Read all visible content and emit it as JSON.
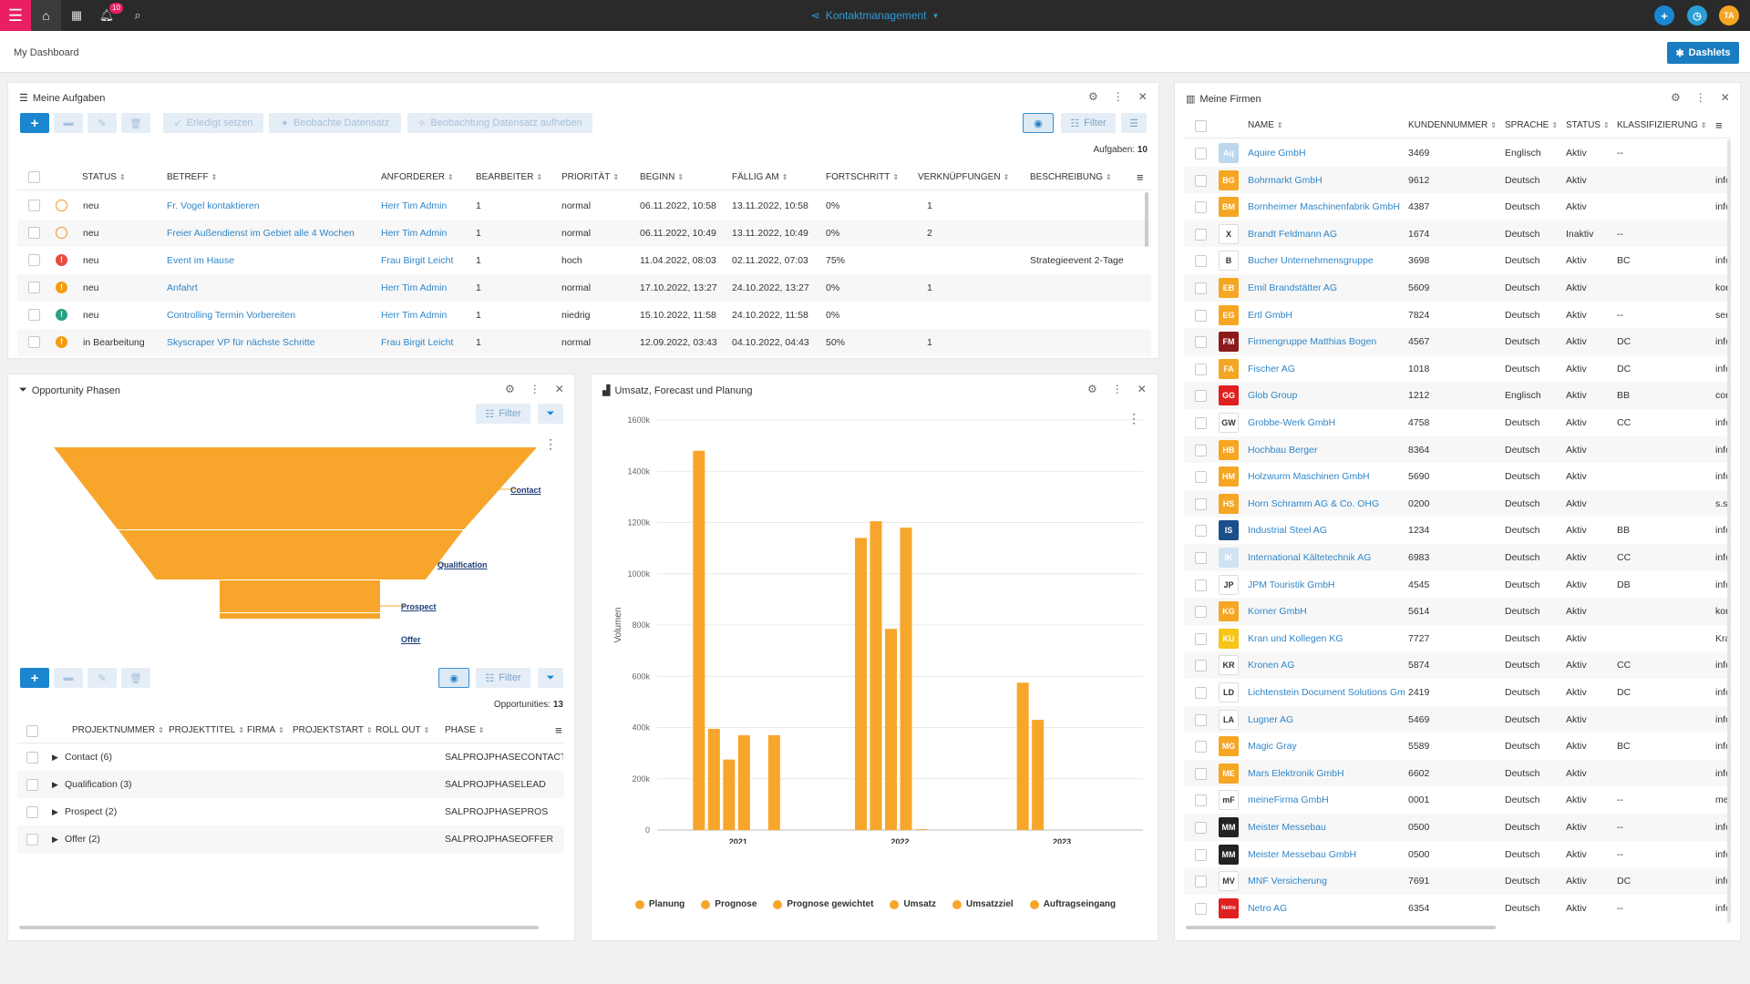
{
  "topbar": {
    "app_title": "Kontaktmanagement",
    "notification_count": "10",
    "user_initials": "TA"
  },
  "header": {
    "title": "My Dashboard",
    "dashlets_label": "Dashlets"
  },
  "tasks": {
    "title": "Meine Aufgaben",
    "toolbar": {
      "erledigt": "Erledigt setzen",
      "beobachte": "Beobachte Datensatz",
      "beobachtung_aufheben": "Beobachtung Datensatz aufheben",
      "filter": "Filter"
    },
    "count_label": "Aufgaben:",
    "count_value": "10",
    "columns": [
      "STATUS",
      "BETREFF",
      "ANFORDERER",
      "BEARBEITER",
      "PRIORITÄT",
      "BEGINN",
      "FÄLLIG AM",
      "FORTSCHRITT",
      "VERKNÜPFUNGEN",
      "BESCHREIBUNG"
    ],
    "rows": [
      {
        "icon": "open",
        "status": "neu",
        "betreff": "Fr. Vogel kontaktieren",
        "anforderer": "Herr Tim Admin",
        "bearbeiter": "1",
        "prioritaet": "normal",
        "beginn": "06.11.2022, 10:58",
        "faellig": "13.11.2022, 10:58",
        "fortschritt": "0%",
        "verknuepfungen": "1",
        "beschreibung": ""
      },
      {
        "icon": "open",
        "status": "neu",
        "betreff": "Freier Außendienst im Gebiet alle 4 Wochen",
        "anforderer": "Herr Tim Admin",
        "bearbeiter": "1",
        "prioritaet": "normal",
        "beginn": "06.11.2022, 10:49",
        "faellig": "13.11.2022, 10:49",
        "fortschritt": "0%",
        "verknuepfungen": "2",
        "beschreibung": ""
      },
      {
        "icon": "high",
        "status": "neu",
        "betreff": "Event im Hause",
        "anforderer": "Frau Birgit Leicht",
        "bearbeiter": "1",
        "prioritaet": "hoch",
        "beginn": "11.04.2022, 08:03",
        "faellig": "02.11.2022, 07:03",
        "fortschritt": "75%",
        "verknuepfungen": "",
        "beschreibung": "Strategieevent 2-Tage"
      },
      {
        "icon": "normal",
        "status": "neu",
        "betreff": "Anfahrt",
        "anforderer": "Herr Tim Admin",
        "bearbeiter": "1",
        "prioritaet": "normal",
        "beginn": "17.10.2022, 13:27",
        "faellig": "24.10.2022, 13:27",
        "fortschritt": "0%",
        "verknuepfungen": "1",
        "beschreibung": ""
      },
      {
        "icon": "low",
        "status": "neu",
        "betreff": "Controlling Termin Vorbereiten",
        "anforderer": "Herr Tim Admin",
        "bearbeiter": "1",
        "prioritaet": "niedrig",
        "beginn": "15.10.2022, 11:58",
        "faellig": "24.10.2022, 11:58",
        "fortschritt": "0%",
        "verknuepfungen": "",
        "beschreibung": ""
      },
      {
        "icon": "normal",
        "status": "in Bearbeitung",
        "betreff": "Skyscraper VP für nächste Schritte",
        "anforderer": "Frau Birgit Leicht",
        "bearbeiter": "1",
        "prioritaet": "normal",
        "beginn": "12.09.2022, 03:43",
        "faellig": "04.10.2022, 04:43",
        "fortschritt": "50%",
        "verknuepfungen": "1",
        "beschreibung": ""
      }
    ]
  },
  "opportunities": {
    "title": "Opportunity Phasen",
    "filter_label": "Filter",
    "funnel_labels": [
      "Contact",
      "Qualification",
      "Prospect",
      "Offer"
    ],
    "count_label": "Opportunities:",
    "count_value": "13",
    "columns": [
      "PROJEKTNUMMER",
      "PROJEKTTITEL",
      "FIRMA",
      "PROJEKTSTART",
      "ROLL OUT",
      "PHASE"
    ],
    "groups": [
      {
        "label": "Contact (6)",
        "phase": "SALPROJPHASECONTACT"
      },
      {
        "label": "Qualification (3)",
        "phase": "SALPROJPHASELEAD"
      },
      {
        "label": "Prospect (2)",
        "phase": "SALPROJPHASEPROS"
      },
      {
        "label": "Offer (2)",
        "phase": "SALPROJPHASEOFFER"
      }
    ]
  },
  "revenue": {
    "title": "Umsatz, Forecast und Planung"
  },
  "chart_data": {
    "type": "bar",
    "title": "",
    "ylabel": "Volumen",
    "ylim": [
      0,
      1600
    ],
    "yticks": [
      "0",
      "200k",
      "400k",
      "600k",
      "800k",
      "1000k",
      "1200k",
      "1400k",
      "1600k"
    ],
    "categories": [
      "2021",
      "2022",
      "2023"
    ],
    "series": [
      {
        "name": "Planung",
        "values": [
          1480,
          1140,
          575
        ]
      },
      {
        "name": "Prognose",
        "values": [
          395,
          1205,
          430
        ]
      },
      {
        "name": "Prognose gewichtet",
        "values": [
          275,
          785,
          0
        ]
      },
      {
        "name": "Umsatz",
        "values": [
          370,
          1180,
          0
        ]
      },
      {
        "name": "Umsatzziel",
        "values": [
          0,
          3,
          0
        ]
      },
      {
        "name": "Auftragseingang",
        "values": [
          370,
          0,
          0
        ]
      }
    ],
    "colors": {
      "bar": "#f7a62b"
    },
    "grid": true,
    "legend": "bottom"
  },
  "companies": {
    "title": "Meine Firmen",
    "columns": [
      "NAME",
      "KUNDENNUMMER",
      "SPRACHE",
      "STATUS",
      "KLASSIFIZIERUNG"
    ],
    "rows": [
      {
        "logo": "Aq",
        "color": "#bcd7ee",
        "name": "Aquire GmbH",
        "nr": "3469",
        "sprache": "Englisch",
        "status": "Aktiv",
        "klass": "--",
        "extra": ""
      },
      {
        "logo": "BG",
        "color": "#f5a623",
        "name": "Bohrmarkt GmbH",
        "nr": "9612",
        "sprache": "Deutsch",
        "status": "Aktiv",
        "klass": "",
        "extra": "info"
      },
      {
        "logo": "BM",
        "color": "#f5a623",
        "name": "Bornheimer Maschinenfabrik GmbH",
        "nr": "4387",
        "sprache": "Deutsch",
        "status": "Aktiv",
        "klass": "",
        "extra": "info"
      },
      {
        "logo": "X",
        "color": "#ffffff",
        "name": "Brandt Feldmann AG",
        "nr": "1674",
        "sprache": "Deutsch",
        "status": "Inaktiv",
        "klass": "--",
        "extra": ""
      },
      {
        "logo": "B",
        "color": "#ffffff",
        "name": "Bucher Unternehmensgruppe",
        "nr": "3698",
        "sprache": "Deutsch",
        "status": "Aktiv",
        "klass": "BC",
        "extra": "info"
      },
      {
        "logo": "EB",
        "color": "#f5a623",
        "name": "Emil Brandstätter AG",
        "nr": "5609",
        "sprache": "Deutsch",
        "status": "Aktiv",
        "klass": "",
        "extra": "kor"
      },
      {
        "logo": "EG",
        "color": "#f5a623",
        "name": "Ertl GmbH",
        "nr": "7824",
        "sprache": "Deutsch",
        "status": "Aktiv",
        "klass": "--",
        "extra": "ser"
      },
      {
        "logo": "FM",
        "color": "#8b1a1a",
        "name": "Firmengruppe Matthias Bogen",
        "nr": "4567",
        "sprache": "Deutsch",
        "status": "Aktiv",
        "klass": "DC",
        "extra": "info"
      },
      {
        "logo": "FA",
        "color": "#f5a623",
        "name": "Fischer AG",
        "nr": "1018",
        "sprache": "Deutsch",
        "status": "Aktiv",
        "klass": "DC",
        "extra": "info"
      },
      {
        "logo": "GG",
        "color": "#e02020",
        "name": "Glob Group",
        "nr": "1212",
        "sprache": "Englisch",
        "status": "Aktiv",
        "klass": "BB",
        "extra": "cor"
      },
      {
        "logo": "GW",
        "color": "#ffffff",
        "name": "Grobbe-Werk GmbH",
        "nr": "4758",
        "sprache": "Deutsch",
        "status": "Aktiv",
        "klass": "CC",
        "extra": "info"
      },
      {
        "logo": "HB",
        "color": "#f5a623",
        "name": "Hochbau Berger",
        "nr": "8364",
        "sprache": "Deutsch",
        "status": "Aktiv",
        "klass": "",
        "extra": "info"
      },
      {
        "logo": "HM",
        "color": "#f5a623",
        "name": "Holzwurm Maschinen GmbH",
        "nr": "5690",
        "sprache": "Deutsch",
        "status": "Aktiv",
        "klass": "",
        "extra": "info"
      },
      {
        "logo": "HS",
        "color": "#f5a623",
        "name": "Horn Schramm AG & Co. OHG",
        "nr": "0200",
        "sprache": "Deutsch",
        "status": "Aktiv",
        "klass": "",
        "extra": "s.sc"
      },
      {
        "logo": "IS",
        "color": "#1b4f8a",
        "name": "Industrial Steel AG",
        "nr": "1234",
        "sprache": "Deutsch",
        "status": "Aktiv",
        "klass": "BB",
        "extra": "info"
      },
      {
        "logo": "IK",
        "color": "#cfe3f5",
        "name": "International Kältetechnik AG",
        "nr": "6983",
        "sprache": "Deutsch",
        "status": "Aktiv",
        "klass": "CC",
        "extra": "info"
      },
      {
        "logo": "JP",
        "color": "#ffffff",
        "name": "JPM Touristik GmbH",
        "nr": "4545",
        "sprache": "Deutsch",
        "status": "Aktiv",
        "klass": "DB",
        "extra": "info"
      },
      {
        "logo": "KG",
        "color": "#f5a623",
        "name": "Korner GmbH",
        "nr": "5614",
        "sprache": "Deutsch",
        "status": "Aktiv",
        "klass": "",
        "extra": "kor"
      },
      {
        "logo": "KU",
        "color": "#f5c518",
        "name": "Kran und Kollegen KG",
        "nr": "7727",
        "sprache": "Deutsch",
        "status": "Aktiv",
        "klass": "",
        "extra": "Kra"
      },
      {
        "logo": "KR",
        "color": "#ffffff",
        "name": "Kronen AG",
        "nr": "5874",
        "sprache": "Deutsch",
        "status": "Aktiv",
        "klass": "CC",
        "extra": "info"
      },
      {
        "logo": "LD",
        "color": "#ffffff",
        "name": "Lichtenstein Document Solutions GmbH",
        "nr": "2419",
        "sprache": "Deutsch",
        "status": "Aktiv",
        "klass": "DC",
        "extra": "info"
      },
      {
        "logo": "LA",
        "color": "#ffffff",
        "name": "Lugner AG",
        "nr": "5469",
        "sprache": "Deutsch",
        "status": "Aktiv",
        "klass": "",
        "extra": "info"
      },
      {
        "logo": "MG",
        "color": "#f5a623",
        "name": "Magic Gray",
        "nr": "5589",
        "sprache": "Deutsch",
        "status": "Aktiv",
        "klass": "BC",
        "extra": "info"
      },
      {
        "logo": "ME",
        "color": "#f5a623",
        "name": "Mars Elektronik GmbH",
        "nr": "6602",
        "sprache": "Deutsch",
        "status": "Aktiv",
        "klass": "",
        "extra": "info"
      },
      {
        "logo": "mF",
        "color": "#ffffff",
        "name": "meineFirma GmbH",
        "nr": "0001",
        "sprache": "Deutsch",
        "status": "Aktiv",
        "klass": "--",
        "extra": "me"
      },
      {
        "logo": "MM",
        "color": "#222222",
        "name": "Meister Messebau",
        "nr": "0500",
        "sprache": "Deutsch",
        "status": "Aktiv",
        "klass": "--",
        "extra": "info"
      },
      {
        "logo": "MM",
        "color": "#222222",
        "name": "Meister Messebau GmbH",
        "nr": "0500",
        "sprache": "Deutsch",
        "status": "Aktiv",
        "klass": "--",
        "extra": "info"
      },
      {
        "logo": "MV",
        "color": "#ffffff",
        "name": "MNF Versicherung",
        "nr": "7691",
        "sprache": "Deutsch",
        "status": "Aktiv",
        "klass": "DC",
        "extra": "info"
      },
      {
        "logo": "Netro",
        "color": "#e02020",
        "name": "Netro AG",
        "nr": "6354",
        "sprache": "Deutsch",
        "status": "Aktiv",
        "klass": "--",
        "extra": "info"
      }
    ]
  }
}
